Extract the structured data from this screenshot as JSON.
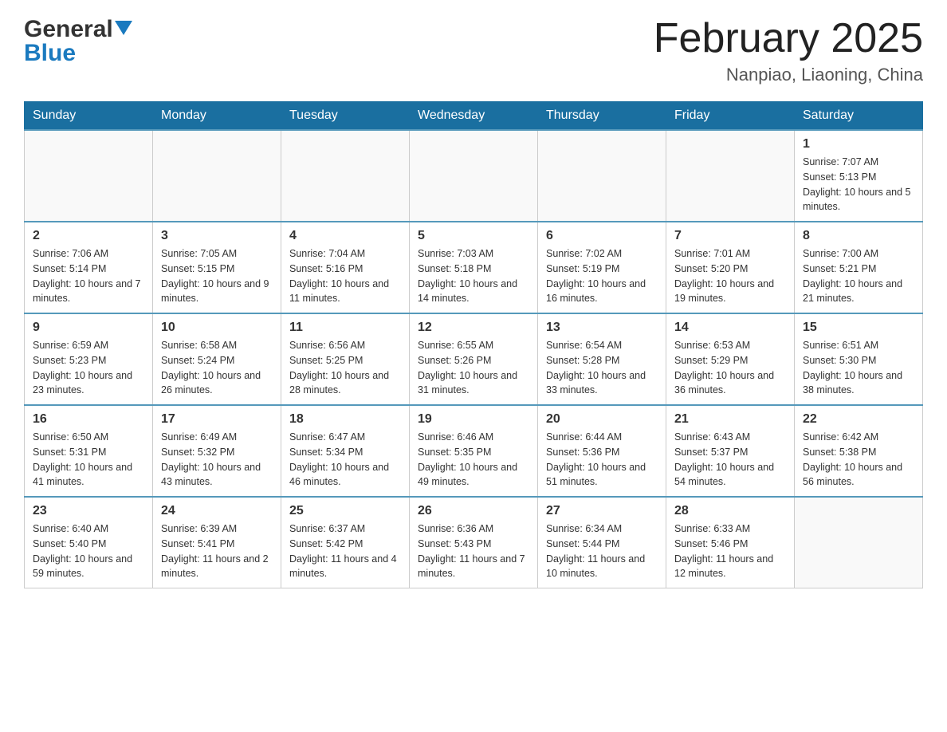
{
  "logo": {
    "general": "General",
    "blue": "Blue"
  },
  "header": {
    "month": "February 2025",
    "location": "Nanpiao, Liaoning, China"
  },
  "weekdays": [
    "Sunday",
    "Monday",
    "Tuesday",
    "Wednesday",
    "Thursday",
    "Friday",
    "Saturday"
  ],
  "weeks": [
    [
      {
        "day": "",
        "info": ""
      },
      {
        "day": "",
        "info": ""
      },
      {
        "day": "",
        "info": ""
      },
      {
        "day": "",
        "info": ""
      },
      {
        "day": "",
        "info": ""
      },
      {
        "day": "",
        "info": ""
      },
      {
        "day": "1",
        "info": "Sunrise: 7:07 AM\nSunset: 5:13 PM\nDaylight: 10 hours and 5 minutes."
      }
    ],
    [
      {
        "day": "2",
        "info": "Sunrise: 7:06 AM\nSunset: 5:14 PM\nDaylight: 10 hours and 7 minutes."
      },
      {
        "day": "3",
        "info": "Sunrise: 7:05 AM\nSunset: 5:15 PM\nDaylight: 10 hours and 9 minutes."
      },
      {
        "day": "4",
        "info": "Sunrise: 7:04 AM\nSunset: 5:16 PM\nDaylight: 10 hours and 11 minutes."
      },
      {
        "day": "5",
        "info": "Sunrise: 7:03 AM\nSunset: 5:18 PM\nDaylight: 10 hours and 14 minutes."
      },
      {
        "day": "6",
        "info": "Sunrise: 7:02 AM\nSunset: 5:19 PM\nDaylight: 10 hours and 16 minutes."
      },
      {
        "day": "7",
        "info": "Sunrise: 7:01 AM\nSunset: 5:20 PM\nDaylight: 10 hours and 19 minutes."
      },
      {
        "day": "8",
        "info": "Sunrise: 7:00 AM\nSunset: 5:21 PM\nDaylight: 10 hours and 21 minutes."
      }
    ],
    [
      {
        "day": "9",
        "info": "Sunrise: 6:59 AM\nSunset: 5:23 PM\nDaylight: 10 hours and 23 minutes."
      },
      {
        "day": "10",
        "info": "Sunrise: 6:58 AM\nSunset: 5:24 PM\nDaylight: 10 hours and 26 minutes."
      },
      {
        "day": "11",
        "info": "Sunrise: 6:56 AM\nSunset: 5:25 PM\nDaylight: 10 hours and 28 minutes."
      },
      {
        "day": "12",
        "info": "Sunrise: 6:55 AM\nSunset: 5:26 PM\nDaylight: 10 hours and 31 minutes."
      },
      {
        "day": "13",
        "info": "Sunrise: 6:54 AM\nSunset: 5:28 PM\nDaylight: 10 hours and 33 minutes."
      },
      {
        "day": "14",
        "info": "Sunrise: 6:53 AM\nSunset: 5:29 PM\nDaylight: 10 hours and 36 minutes."
      },
      {
        "day": "15",
        "info": "Sunrise: 6:51 AM\nSunset: 5:30 PM\nDaylight: 10 hours and 38 minutes."
      }
    ],
    [
      {
        "day": "16",
        "info": "Sunrise: 6:50 AM\nSunset: 5:31 PM\nDaylight: 10 hours and 41 minutes."
      },
      {
        "day": "17",
        "info": "Sunrise: 6:49 AM\nSunset: 5:32 PM\nDaylight: 10 hours and 43 minutes."
      },
      {
        "day": "18",
        "info": "Sunrise: 6:47 AM\nSunset: 5:34 PM\nDaylight: 10 hours and 46 minutes."
      },
      {
        "day": "19",
        "info": "Sunrise: 6:46 AM\nSunset: 5:35 PM\nDaylight: 10 hours and 49 minutes."
      },
      {
        "day": "20",
        "info": "Sunrise: 6:44 AM\nSunset: 5:36 PM\nDaylight: 10 hours and 51 minutes."
      },
      {
        "day": "21",
        "info": "Sunrise: 6:43 AM\nSunset: 5:37 PM\nDaylight: 10 hours and 54 minutes."
      },
      {
        "day": "22",
        "info": "Sunrise: 6:42 AM\nSunset: 5:38 PM\nDaylight: 10 hours and 56 minutes."
      }
    ],
    [
      {
        "day": "23",
        "info": "Sunrise: 6:40 AM\nSunset: 5:40 PM\nDaylight: 10 hours and 59 minutes."
      },
      {
        "day": "24",
        "info": "Sunrise: 6:39 AM\nSunset: 5:41 PM\nDaylight: 11 hours and 2 minutes."
      },
      {
        "day": "25",
        "info": "Sunrise: 6:37 AM\nSunset: 5:42 PM\nDaylight: 11 hours and 4 minutes."
      },
      {
        "day": "26",
        "info": "Sunrise: 6:36 AM\nSunset: 5:43 PM\nDaylight: 11 hours and 7 minutes."
      },
      {
        "day": "27",
        "info": "Sunrise: 6:34 AM\nSunset: 5:44 PM\nDaylight: 11 hours and 10 minutes."
      },
      {
        "day": "28",
        "info": "Sunrise: 6:33 AM\nSunset: 5:46 PM\nDaylight: 11 hours and 12 minutes."
      },
      {
        "day": "",
        "info": ""
      }
    ]
  ]
}
